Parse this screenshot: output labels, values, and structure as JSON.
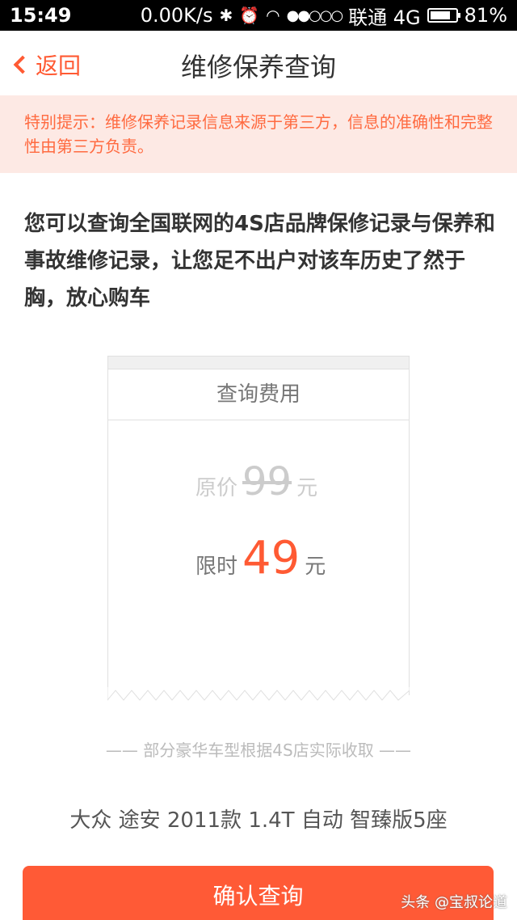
{
  "status_bar": {
    "time": "15:49",
    "speed": "0.00K/s",
    "bluetooth_icon": "bluetooth-icon",
    "alarm_icon": "alarm-icon",
    "wifi_icon": "wifi-icon",
    "signal": "●●○○○",
    "carrier": "联通 4G",
    "battery_percent": "81%",
    "battery_level": 0.81
  },
  "nav": {
    "back_label": "返回",
    "title": "维修保养查询"
  },
  "notice": {
    "text": "特别提示：维修保养记录信息来源于第三方，信息的准确性和完整性由第三方负责。"
  },
  "intro": {
    "text": "您可以查询全国联网的4S店品牌保修记录与保养和事故维修记录，让您足不出户对该车历史了然于胸，放心购车"
  },
  "ticket": {
    "header": "查询费用",
    "original_label": "原价",
    "original_price": "99",
    "original_unit": "元",
    "limited_label": "限时",
    "limited_price": "49",
    "limited_unit": "元"
  },
  "note": "—— 部分豪华车型根据4S店实际收取 ——",
  "car_model": "大众 途安 2011款 1.4T 自动 智臻版5座",
  "confirm_button": "确认查询",
  "watermark": "头条 @宝叔论道",
  "colors": {
    "accent": "#ff5a33",
    "notice_bg": "#fde9e4",
    "notice_text": "#ff6a40"
  }
}
